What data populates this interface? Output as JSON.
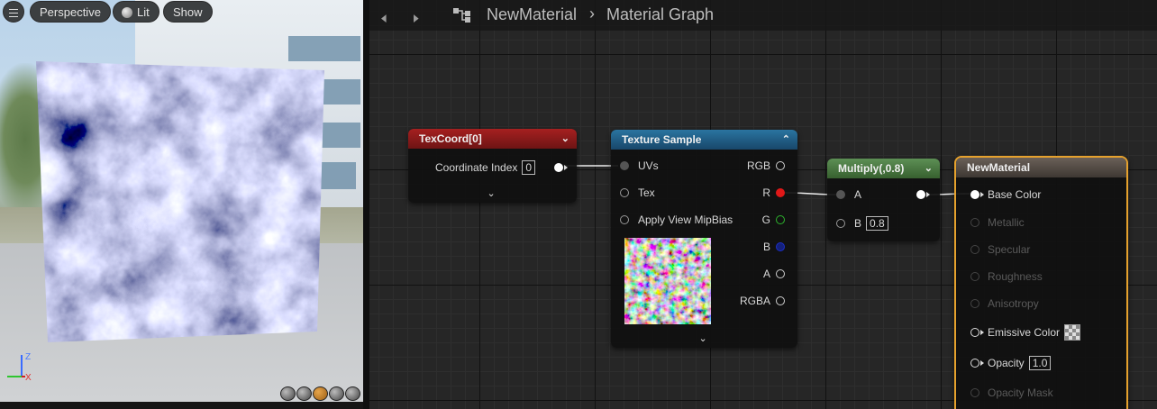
{
  "viewport": {
    "perspective_label": "Perspective",
    "lit_label": "Lit",
    "show_label": "Show",
    "axis_z": "Z",
    "axis_x": "X"
  },
  "toolbar": {
    "asset_name": "NewMaterial",
    "graph_name": "Material Graph"
  },
  "nodes": {
    "texcoord": {
      "title": "TexCoord[0]",
      "row_label": "Coordinate Index",
      "row_value": "0"
    },
    "texture": {
      "title": "Texture Sample",
      "inputs": [
        "UVs",
        "Tex",
        "Apply View MipBias"
      ],
      "outputs": [
        "RGB",
        "R",
        "G",
        "B",
        "A",
        "RGBA"
      ]
    },
    "multiply": {
      "title": "Multiply(,0.8)",
      "input_a": "A",
      "input_b": "B",
      "b_value": "0.8"
    },
    "material": {
      "title": "NewMaterial",
      "base_color": "Base Color",
      "metallic": "Metallic",
      "specular": "Specular",
      "roughness": "Roughness",
      "anisotropy": "Anisotropy",
      "emissive": "Emissive Color",
      "opacity": "Opacity",
      "opacity_value": "1.0",
      "opacity_mask": "Opacity Mask"
    }
  },
  "colors": {
    "texcoord_header": "#8c1a1a",
    "texture_header": "#1e5a7c",
    "multiply_header": "#3d6b35",
    "material_header": "#4a4540",
    "selection": "#e5a12d",
    "pin_r": "#e01818",
    "pin_g": "#2db52d",
    "pin_b": "#1b2fc9"
  }
}
